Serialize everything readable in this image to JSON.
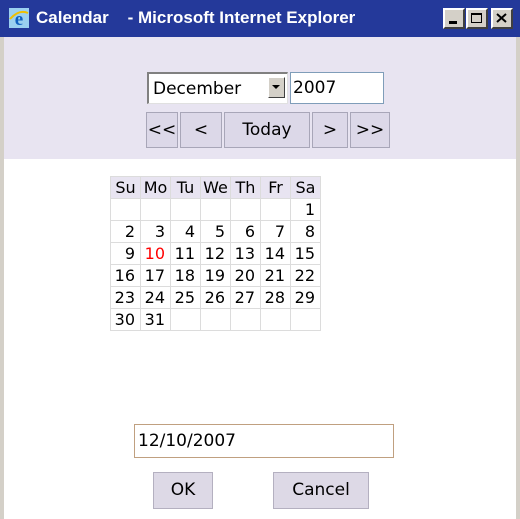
{
  "window": {
    "title": "Calendar    - Microsoft Internet Explorer",
    "controls": [
      "minimize",
      "maximize",
      "close"
    ]
  },
  "month_select": {
    "value": "December"
  },
  "year_input": {
    "value": "2007"
  },
  "nav": {
    "prev_year": "<<",
    "prev_month": "<",
    "today": "Today",
    "next_month": ">",
    "next_year": ">>"
  },
  "calendar": {
    "weekdays": [
      "Su",
      "Mo",
      "Tu",
      "We",
      "Th",
      "Fr",
      "Sa"
    ],
    "weeks": [
      [
        "",
        "",
        "",
        "",
        "",
        "",
        "1"
      ],
      [
        "2",
        "3",
        "4",
        "5",
        "6",
        "7",
        "8"
      ],
      [
        "9",
        "10",
        "11",
        "12",
        "13",
        "14",
        "15"
      ],
      [
        "16",
        "17",
        "18",
        "19",
        "20",
        "21",
        "22"
      ],
      [
        "23",
        "24",
        "25",
        "26",
        "27",
        "28",
        "29"
      ],
      [
        "30",
        "31",
        "",
        "",
        "",
        "",
        ""
      ]
    ],
    "highlighted_day": "10",
    "highlight_color": "#ff0000"
  },
  "date_input": {
    "value": "12/10/2007"
  },
  "buttons": {
    "ok": "OK",
    "cancel": "Cancel"
  }
}
